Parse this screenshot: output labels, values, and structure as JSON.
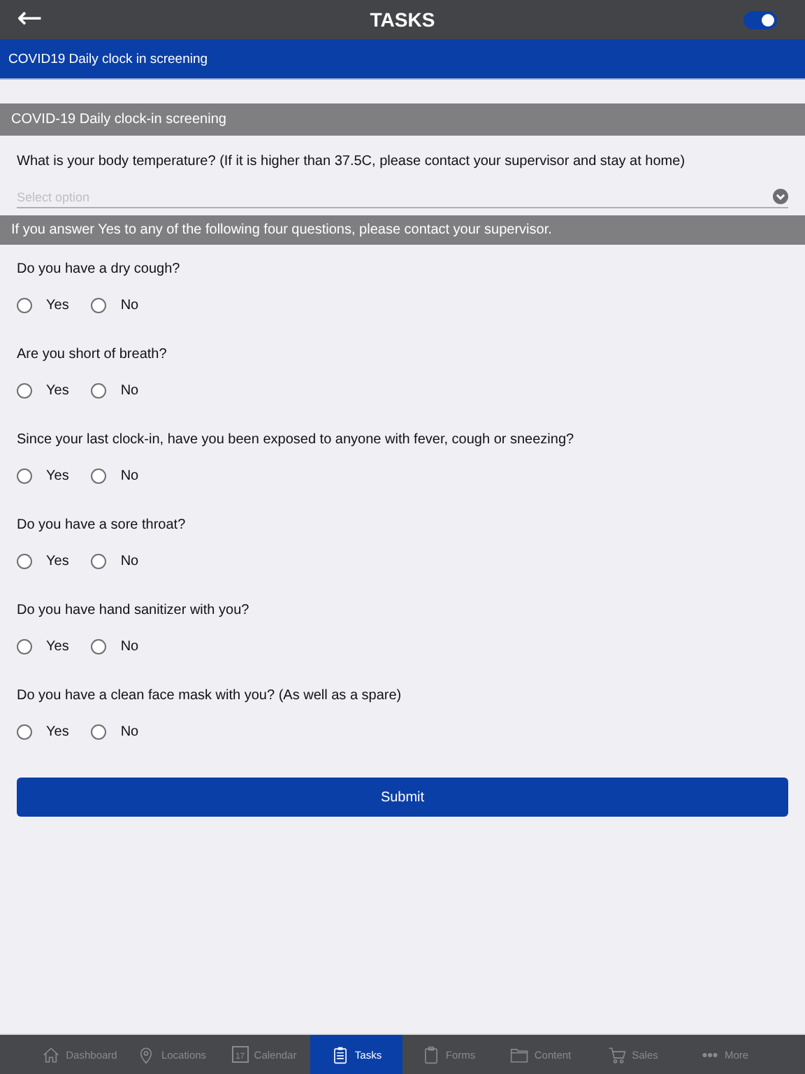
{
  "header": {
    "title": "TASKS",
    "back_icon": "←",
    "toggle_on": true
  },
  "form_title": "COVID19 Daily clock in screening",
  "section": "COVID-19 Daily clock-in screening",
  "temperature": {
    "question": "What is your body temperature? (If it is higher than 37.5C, please contact your supervisor and stay at home)",
    "placeholder": "Select option"
  },
  "note": "If you answer Yes to any of the following four questions, please contact your supervisor.",
  "questions": [
    {
      "label": "Do you have a dry cough?",
      "options": [
        {
          "label": "Yes",
          "selected": false
        },
        {
          "label": "No",
          "selected": false
        }
      ]
    },
    {
      "label": "Are you short of breath?",
      "options": [
        {
          "label": "Yes",
          "selected": false
        },
        {
          "label": "No",
          "selected": false
        }
      ]
    },
    {
      "label": "Since your last clock-in, have you been exposed to anyone with fever, cough or sneezing?",
      "options": [
        {
          "label": "Yes",
          "selected": false
        },
        {
          "label": "No",
          "selected": false
        }
      ]
    },
    {
      "label": "Do you have a sore throat?",
      "options": [
        {
          "label": "Yes",
          "selected": false
        },
        {
          "label": "No",
          "selected": false
        }
      ]
    },
    {
      "label": "Do you have hand sanitizer with you?",
      "options": [
        {
          "label": "Yes",
          "selected": false
        },
        {
          "label": "No",
          "selected": false
        }
      ]
    },
    {
      "label": "Do you have a clean face mask with you? (As well as a spare)",
      "options": [
        {
          "label": "Yes",
          "selected": false
        },
        {
          "label": "No",
          "selected": false
        }
      ]
    }
  ],
  "submit": "Submit",
  "tabs": [
    {
      "label": "Dashboard",
      "kind": "home",
      "selected": false
    },
    {
      "label": "Locations",
      "kind": "pin",
      "selected": false
    },
    {
      "label": "Calendar",
      "kind": "calendar",
      "icon_text": "17",
      "selected": false
    },
    {
      "label": "Tasks",
      "kind": "clipboard",
      "selected": true
    },
    {
      "label": "Forms",
      "kind": "form",
      "selected": false
    },
    {
      "label": "Content",
      "kind": "folder",
      "selected": false
    },
    {
      "label": "Sales",
      "kind": "cart",
      "selected": false
    },
    {
      "label": "More",
      "kind": "dots",
      "selected": false
    }
  ]
}
